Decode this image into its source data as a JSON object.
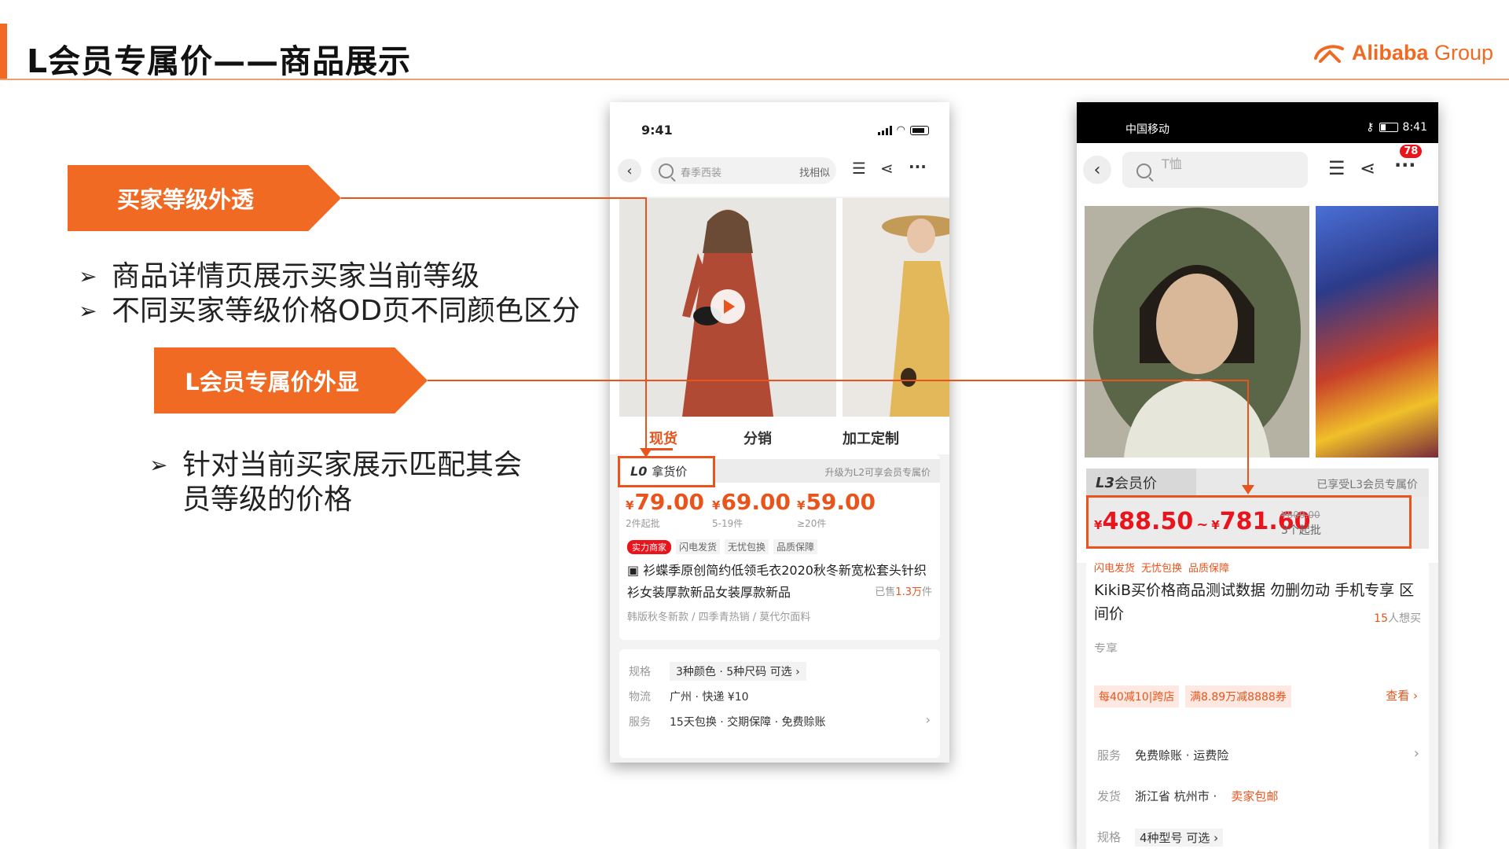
{
  "slide": {
    "title": "L会员专属价——商品展示",
    "logo_brand": "Alibaba",
    "logo_group": "Group"
  },
  "callouts": {
    "buyer_level": "买家等级外透",
    "l_price": "L会员专属价外显"
  },
  "bullets_1": [
    "商品详情页展示买家当前等级",
    "不同买家等级价格OD页不同颜色区分"
  ],
  "bullets_2": [
    "针对当前买家展示匹配其会",
    "员等级的价格"
  ],
  "phone1": {
    "time": "9:41",
    "search_placeholder": "春季西装",
    "search_similar": "找相似",
    "tabs": [
      "现货",
      "分销",
      "加工定制"
    ],
    "level_tag": "L0",
    "level_label": "拿货价",
    "upgrade_note": "升级为L2可享会员专属价",
    "prices": [
      {
        "amount": "79.00",
        "note": "2件起批"
      },
      {
        "amount": "69.00",
        "note": "5-19件"
      },
      {
        "amount": "59.00",
        "note": "≥20件"
      }
    ],
    "currency": "¥",
    "tag_merchant": "实力商家",
    "tag_ship": "闪电发货",
    "tag_worry": "无忧包换",
    "tag_quality": "品质保障",
    "product_title": "衫蝶季原创简约低领毛衣2020秋冬新宽松套头针织衫女装厚款新品女装厚款新品",
    "sold_prefix": "已售",
    "sold_count": "1.3万",
    "sold_unit": "件",
    "keywords": "韩版秋冬新款 / 四季青热销 / 莫代尔面料",
    "spec_label": "规格",
    "spec_value": "3种颜色 · 5种尺码 可选 ›",
    "logistics_label": "物流",
    "logistics_value": "广州 · 快递 ¥10",
    "service_label": "服务",
    "service_value": "15天包换 · 交期保障 · 免费赊账"
  },
  "phone2": {
    "carrier": "中国移动",
    "time": "8:41",
    "search_placeholder": "T恤",
    "cart_badge": "78",
    "level_tag": "L3",
    "level_label": "会员价",
    "level_note": "已享受L3会员专属价",
    "currency": "¥",
    "price_low": "488.50",
    "price_high": "781.60",
    "price_sep": "~",
    "orig_price": "¥800.00",
    "min_order": "3个起批",
    "tags": [
      "闪电发货",
      "无忧包换",
      "品质保障"
    ],
    "product_title": "KikiB买价格商品测试数据 勿删勿动 手机专享 区间价",
    "want_count": "15",
    "want_suffix": "人想买",
    "exclusive": "专享",
    "coupon_1": "每40减10|跨店",
    "coupon_2": "满8.89万减8888券",
    "view_label": "查看 ›",
    "service_label": "服务",
    "service_value": "免费赊账 · 运费险",
    "ship_label": "发货",
    "ship_value": "浙江省 杭州市 ·",
    "ship_free": "卖家包邮",
    "spec_label": "规格",
    "spec_value": "4种型号 可选 ›"
  },
  "colors": {
    "accent": "#f06a23",
    "price_red": "#e9141c",
    "line": "#e9541c"
  }
}
